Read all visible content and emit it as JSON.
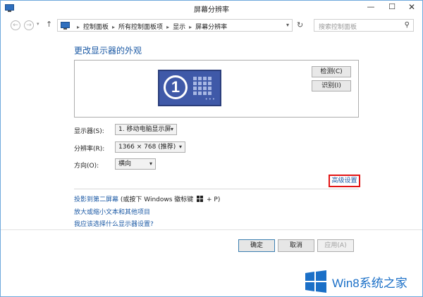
{
  "window": {
    "title": "屏幕分辨率",
    "minimize": "—",
    "maximize": "☐",
    "close": "✕"
  },
  "nav": {
    "back_icon": "←",
    "forward_icon": "→",
    "up_icon": "↑",
    "breadcrumbs": [
      "控制面板",
      "所有控制面板项",
      "显示",
      "屏幕分辨率"
    ],
    "search_placeholder": "搜索控制面板"
  },
  "main": {
    "heading": "更改显示器的外观",
    "monitor_number": "1",
    "detect_label": "检测(C)",
    "identify_label": "识别(I)",
    "display": {
      "label": "显示器(S):",
      "value": "1. 移动电脑显示屏"
    },
    "resolution": {
      "label": "分辨率(R):",
      "value": "1366 × 768 (推荐)"
    },
    "orientation": {
      "label": "方向(O):",
      "value": "横向"
    },
    "advanced_link": "高级设置",
    "links": {
      "project_link": "投影到第二屏幕",
      "project_hint_before": " (或按下 Windows 徽标键 ",
      "project_hint_after": " + P)",
      "text_size_link": "放大或缩小文本和其他项目",
      "which_settings_link": "我应该选择什么显示器设置?"
    }
  },
  "footer": {
    "ok": "确定",
    "cancel": "取消",
    "apply": "应用(A)"
  },
  "watermark": {
    "text": "Win8系统之家"
  },
  "colors": {
    "link_blue": "#1c5aa5",
    "highlight_red": "#e21414",
    "monitor_blue": "#3f59a8"
  }
}
